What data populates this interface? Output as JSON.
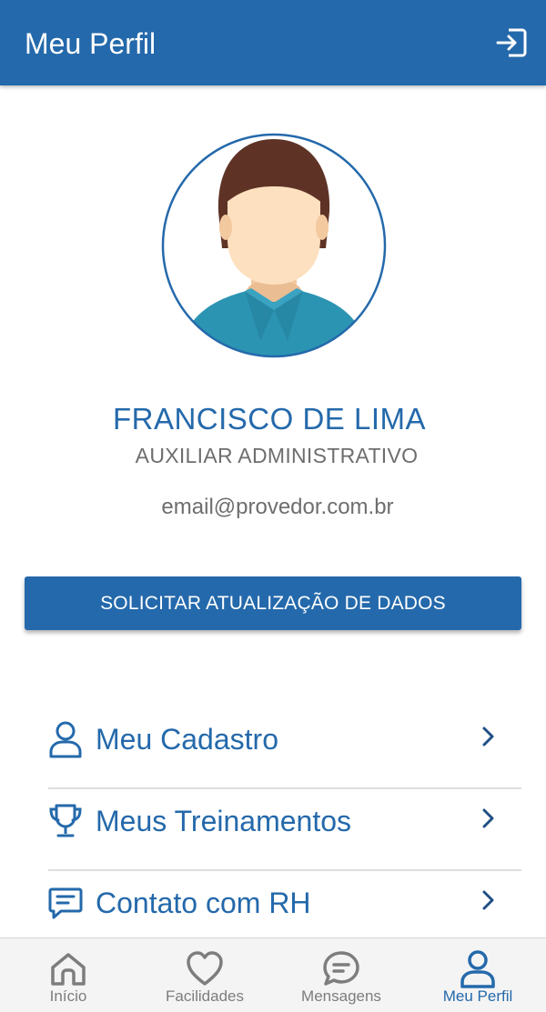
{
  "header": {
    "title": "Meu Perfil",
    "logout_icon": "logout-icon"
  },
  "profile": {
    "name": "FRANCISCO DE LIMA",
    "role": "AUXILIAR ADMINISTRATIVO",
    "email": "email@provedor.com.br",
    "avatar_icon": "user-avatar-illustration"
  },
  "actions": {
    "update_label": "SOLICITAR ATUALIZAÇÃO DE DADOS"
  },
  "menu": {
    "items": [
      {
        "label": "Meu Cadastro",
        "icon": "user-icon"
      },
      {
        "label": "Meus Treinamentos",
        "icon": "trophy-icon"
      },
      {
        "label": "Contato com RH",
        "icon": "message-icon"
      }
    ]
  },
  "nav": {
    "items": [
      {
        "label": "Início",
        "icon": "home-icon",
        "active": false
      },
      {
        "label": "Facilidades",
        "icon": "heart-icon",
        "active": false
      },
      {
        "label": "Mensagens",
        "icon": "chat-icon",
        "active": false
      },
      {
        "label": "Meu Perfil",
        "icon": "user-icon",
        "active": true
      }
    ]
  },
  "colors": {
    "primary": "#2469ab",
    "secondary_text": "#6e6e6e",
    "nav_inactive": "#7d7d7d",
    "divider": "#dedede",
    "skin": "#fde0bf",
    "hair": "#5e3326",
    "shirt": "#2c94b3"
  }
}
